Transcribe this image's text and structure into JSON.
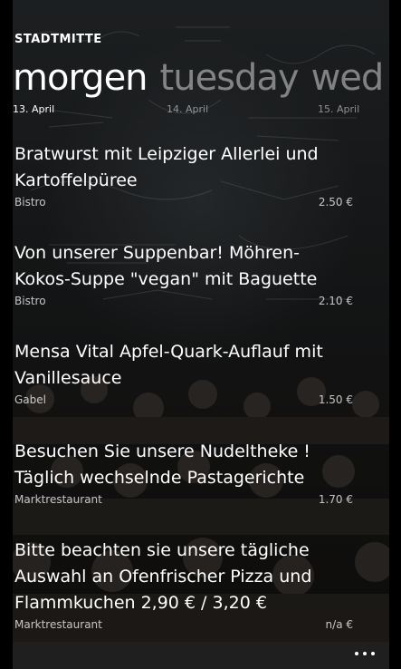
{
  "header": {
    "title": "STADTMITTE"
  },
  "pivot": {
    "tabs": [
      {
        "label": "morgen",
        "date": "13. April"
      },
      {
        "label": "tuesday",
        "date": "14. April"
      },
      {
        "label": "wed",
        "date": "15. April"
      }
    ]
  },
  "menu": [
    {
      "name_lines": [
        "Bratwurst mit Leipziger Allerlei und",
        "Kartoffelpüree"
      ],
      "location": "Bistro",
      "price": "2.50 €"
    },
    {
      "name_lines": [
        "Von unserer Suppenbar! Möhren-",
        "Kokos-Suppe \"vegan\" mit Baguette"
      ],
      "location": "Bistro",
      "price": "2.10 €"
    },
    {
      "name_lines": [
        "Mensa Vital Apfel-Quark-Auflauf mit",
        "Vanillesauce"
      ],
      "location": "Gabel",
      "price": "1.50 €"
    },
    {
      "name_lines": [
        "Besuchen Sie unsere Nudeltheke !",
        "Täglich wechselnde Pastagerichte"
      ],
      "location": "Marktrestaurant",
      "price": "1.70 €"
    },
    {
      "name_lines": [
        "Bitte beachten sie unsere tägliche",
        "Auswahl an Ofenfrischer Pizza und",
        "Flammkuchen 2,90 € / 3,20 €"
      ],
      "location": "Marktrestaurant",
      "price": "n/a €"
    }
  ],
  "appbar": {
    "more_icon": "ellipsis-icon"
  }
}
